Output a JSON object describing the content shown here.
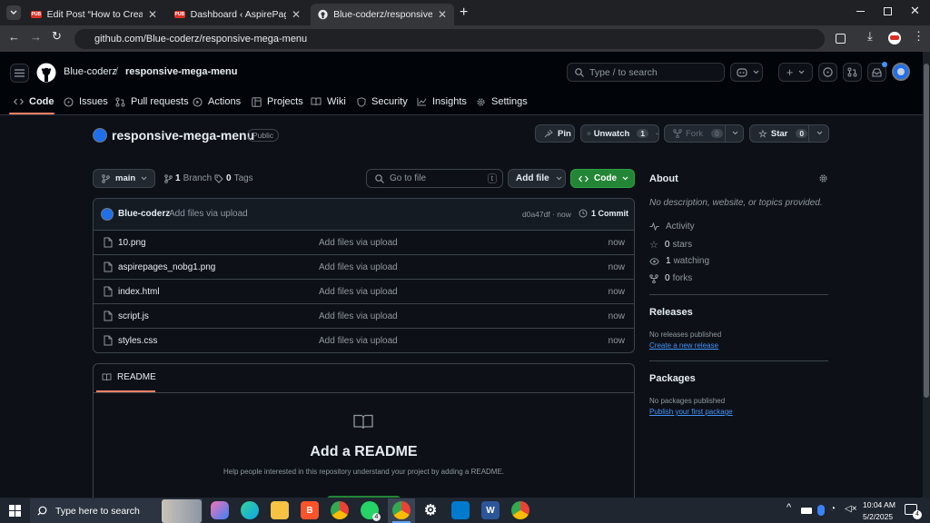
{
  "browser": {
    "tabs": [
      {
        "title": "Edit Post “How to Create a Smo",
        "favicon": "wordpress-red"
      },
      {
        "title": "Dashboard ‹ AspirePages — W",
        "favicon": "wordpress-red"
      },
      {
        "title": "Blue-coderz/responsive-mega-",
        "favicon": "github",
        "active": true
      }
    ],
    "url": "github.com/Blue-coderz/responsive-mega-menu"
  },
  "header": {
    "owner": "Blue-coderz",
    "separator": "/",
    "repo": "responsive-mega-menu",
    "search_placeholder": "Type / to search"
  },
  "repo_nav": [
    {
      "label": "Code",
      "icon": "code-icon",
      "active": true
    },
    {
      "label": "Issues",
      "icon": "issue-icon"
    },
    {
      "label": "Pull requests",
      "icon": "pull-request-icon"
    },
    {
      "label": "Actions",
      "icon": "play-icon"
    },
    {
      "label": "Projects",
      "icon": "table-icon"
    },
    {
      "label": "Wiki",
      "icon": "book-icon"
    },
    {
      "label": "Security",
      "icon": "shield-icon"
    },
    {
      "label": "Insights",
      "icon": "graph-icon"
    },
    {
      "label": "Settings",
      "icon": "gear-icon"
    }
  ],
  "repo_title": {
    "name": "responsive-mega-menu",
    "visibility": "Public"
  },
  "actions": {
    "pin": "Pin",
    "unwatch": "Unwatch",
    "watch_count": "1",
    "fork": "Fork",
    "fork_count": "0",
    "star": "Star",
    "star_count": "0"
  },
  "toolbar": {
    "branch": "main",
    "branches_count": "1",
    "branches_label": "Branch",
    "tags_count": "0",
    "tags_label": "Tags",
    "goto_placeholder": "Go to file",
    "goto_key": "t",
    "add_file": "Add file",
    "code": "Code"
  },
  "commit": {
    "author": "Blue-coderz",
    "message": "Add files via upload",
    "hash_time": "d0a47df · now",
    "commits": "1 Commit"
  },
  "files": [
    {
      "name": "10.png",
      "message": "Add files via upload",
      "time": "now"
    },
    {
      "name": "aspirepages_nobg1.png",
      "message": "Add files via upload",
      "time": "now"
    },
    {
      "name": "index.html",
      "message": "Add files via upload",
      "time": "now"
    },
    {
      "name": "script.js",
      "message": "Add files via upload",
      "time": "now"
    },
    {
      "name": "styles.css",
      "message": "Add files via upload",
      "time": "now"
    }
  ],
  "readme": {
    "tab": "README",
    "heading": "Add a README",
    "description": "Help people interested in this repository understand your project by adding a README."
  },
  "about": {
    "title": "About",
    "description": "No description, website, or topics provided.",
    "activity": "Activity",
    "stars": "0",
    "stars_label": "stars",
    "watching": "1",
    "watching_label": "watching",
    "forks": "0",
    "forks_label": "forks"
  },
  "releases": {
    "title": "Releases",
    "empty": "No releases published",
    "link": "Create a new release"
  },
  "packages": {
    "title": "Packages",
    "empty": "No packages published",
    "link": "Publish your first package"
  },
  "taskbar": {
    "search_placeholder": "Type here to search",
    "time": "10:04 AM",
    "date": "5/2/2025",
    "notification_count": "4"
  },
  "colors": {
    "green": "#238636",
    "accent": "#4493f8",
    "active_underline": "#f78166"
  }
}
